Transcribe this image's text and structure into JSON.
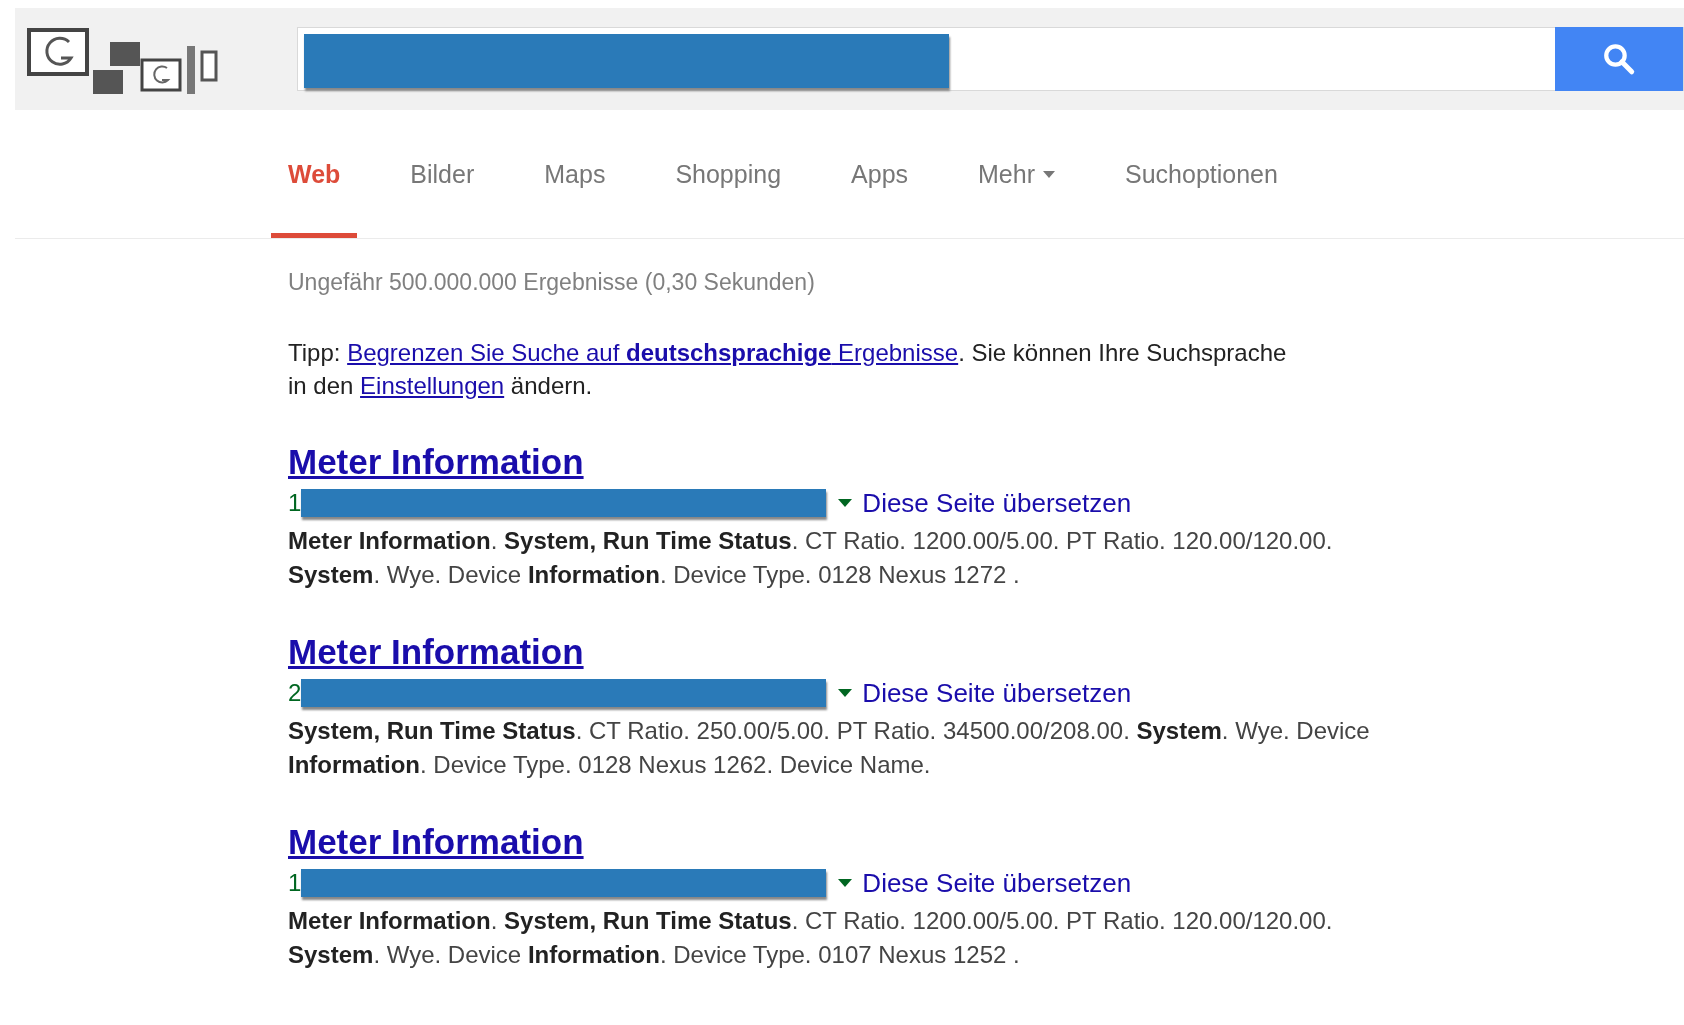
{
  "tabs": [
    {
      "label": "Web",
      "selected": true,
      "kind": "plain"
    },
    {
      "label": "Bilder",
      "selected": false,
      "kind": "plain"
    },
    {
      "label": "Maps",
      "selected": false,
      "kind": "plain"
    },
    {
      "label": "Shopping",
      "selected": false,
      "kind": "plain"
    },
    {
      "label": "Apps",
      "selected": false,
      "kind": "plain"
    },
    {
      "label": "Mehr",
      "selected": false,
      "kind": "dropdown"
    },
    {
      "label": "Suchoptionen",
      "selected": false,
      "kind": "plain"
    }
  ],
  "result_stats": "Ungefähr 500.000.000 Ergebnisse (0,30 Sekunden)",
  "tip": {
    "prefix": "Tipp: ",
    "link": "Begrenzen Sie Suche auf **deutschsprachige** Ergebnisse",
    "middle": ". Sie können Ihre Suchsprache in den ",
    "settings_link": "Einstellungen",
    "suffix": " ändern."
  },
  "results": [
    {
      "title": "Meter Information",
      "url_prefix": "1",
      "translate": "Diese Seite übersetzen",
      "snippet": "**Meter Information**. **System, Run Time Status**. CT Ratio. 1200.00/5.00. PT Ratio. 120.00/120.00. **System**. Wye. Device **Information**. Device Type. 0128 Nexus 1272 ."
    },
    {
      "title": "Meter Information",
      "url_prefix": "2",
      "translate": "Diese Seite übersetzen",
      "snippet": "**System, Run Time Status**. CT Ratio. 250.00/5.00. PT Ratio. 34500.00/208.00. **System**. Wye. Device **Information**. Device Type. 0128 Nexus 1262. Device Name."
    },
    {
      "title": "Meter Information",
      "url_prefix": "1",
      "translate": "Diese Seite übersetzen",
      "snippet": "**Meter Information**. **System, Run Time Status**. CT Ratio. 1200.00/5.00. PT Ratio. 120.00/120.00. **System**. Wye. Device **Information**. Device Type. 0107 Nexus 1252 ."
    }
  ]
}
